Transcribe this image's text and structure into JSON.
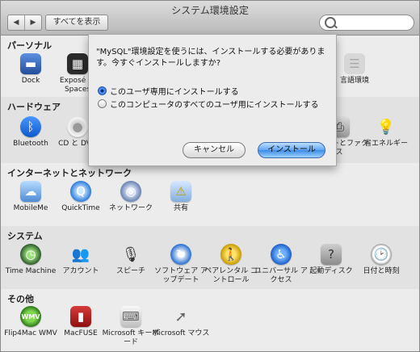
{
  "window": {
    "title": "システム環境設定",
    "nav_back": "◀",
    "nav_forward": "▶",
    "show_all": "すべてを表示",
    "search_placeholder": ""
  },
  "sections": {
    "personal": {
      "title": "パーソナル",
      "items": [
        {
          "label": "Dock",
          "icon": "dock-icon"
        },
        {
          "label": "Exposé と Spaces",
          "icon": "expose-icon"
        },
        {
          "label": "",
          "icon": "personal-faint-icon-1"
        },
        {
          "label": "",
          "icon": "personal-faint-icon-2"
        },
        {
          "label": "",
          "icon": "personal-faint-icon-3"
        },
        {
          "label": "",
          "icon": "personal-faint-icon-4"
        },
        {
          "label": "言語環境",
          "icon": "language-icon"
        }
      ]
    },
    "hardware": {
      "title": "ハードウェア",
      "items": [
        {
          "label": "Bluetooth",
          "icon": "bluetooth-icon"
        },
        {
          "label": "CD と DVD",
          "icon": "cd-dvd-icon"
        },
        {
          "label": "",
          "icon": "hardware-faint-icon-1"
        },
        {
          "label": "",
          "icon": "hardware-faint-icon-2"
        },
        {
          "label": "",
          "icon": "hardware-faint-icon-3"
        },
        {
          "label": "プリントとファクス",
          "icon": "printer-icon"
        },
        {
          "label": "省エネルギー",
          "icon": "energy-saver-icon"
        }
      ]
    },
    "internet": {
      "title": "インターネットとネットワーク",
      "items": [
        {
          "label": "MobileMe",
          "icon": "mobileme-icon"
        },
        {
          "label": "QuickTime",
          "icon": "quicktime-icon"
        },
        {
          "label": "ネットワーク",
          "icon": "network-icon"
        },
        {
          "label": "共有",
          "icon": "sharing-icon"
        }
      ]
    },
    "system": {
      "title": "システム",
      "items": [
        {
          "label": "Time Machine",
          "icon": "time-machine-icon"
        },
        {
          "label": "アカウント",
          "icon": "accounts-icon"
        },
        {
          "label": "スピーチ",
          "icon": "speech-icon"
        },
        {
          "label": "ソフトウェア アップデート",
          "icon": "software-update-icon"
        },
        {
          "label": "ペアレンタル コントロール",
          "icon": "parental-controls-icon"
        },
        {
          "label": "ユニバーサル アクセス",
          "icon": "universal-access-icon"
        },
        {
          "label": "起動ディスク",
          "icon": "startup-disk-icon"
        },
        {
          "label": "日付と時刻",
          "icon": "date-time-icon"
        }
      ]
    },
    "other": {
      "title": "その他",
      "items": [
        {
          "label": "Flip4Mac WMV",
          "icon": "flip4mac-icon"
        },
        {
          "label": "MacFUSE",
          "icon": "macfuse-icon"
        },
        {
          "label": "Microsoft キーボード",
          "icon": "microsoft-keyboard-icon"
        },
        {
          "label": "Microsoft マウス",
          "icon": "microsoft-mouse-icon"
        }
      ]
    }
  },
  "dialog": {
    "message": "\"MySQL\"環境設定を使うには、インストールする必要があります。今すぐインストールしますか?",
    "option_user": "このユーザ専用にインストールする",
    "option_all": "このコンピュータのすべてのユーザ用にインストールする",
    "cancel": "キャンセル",
    "install": "インストール"
  }
}
